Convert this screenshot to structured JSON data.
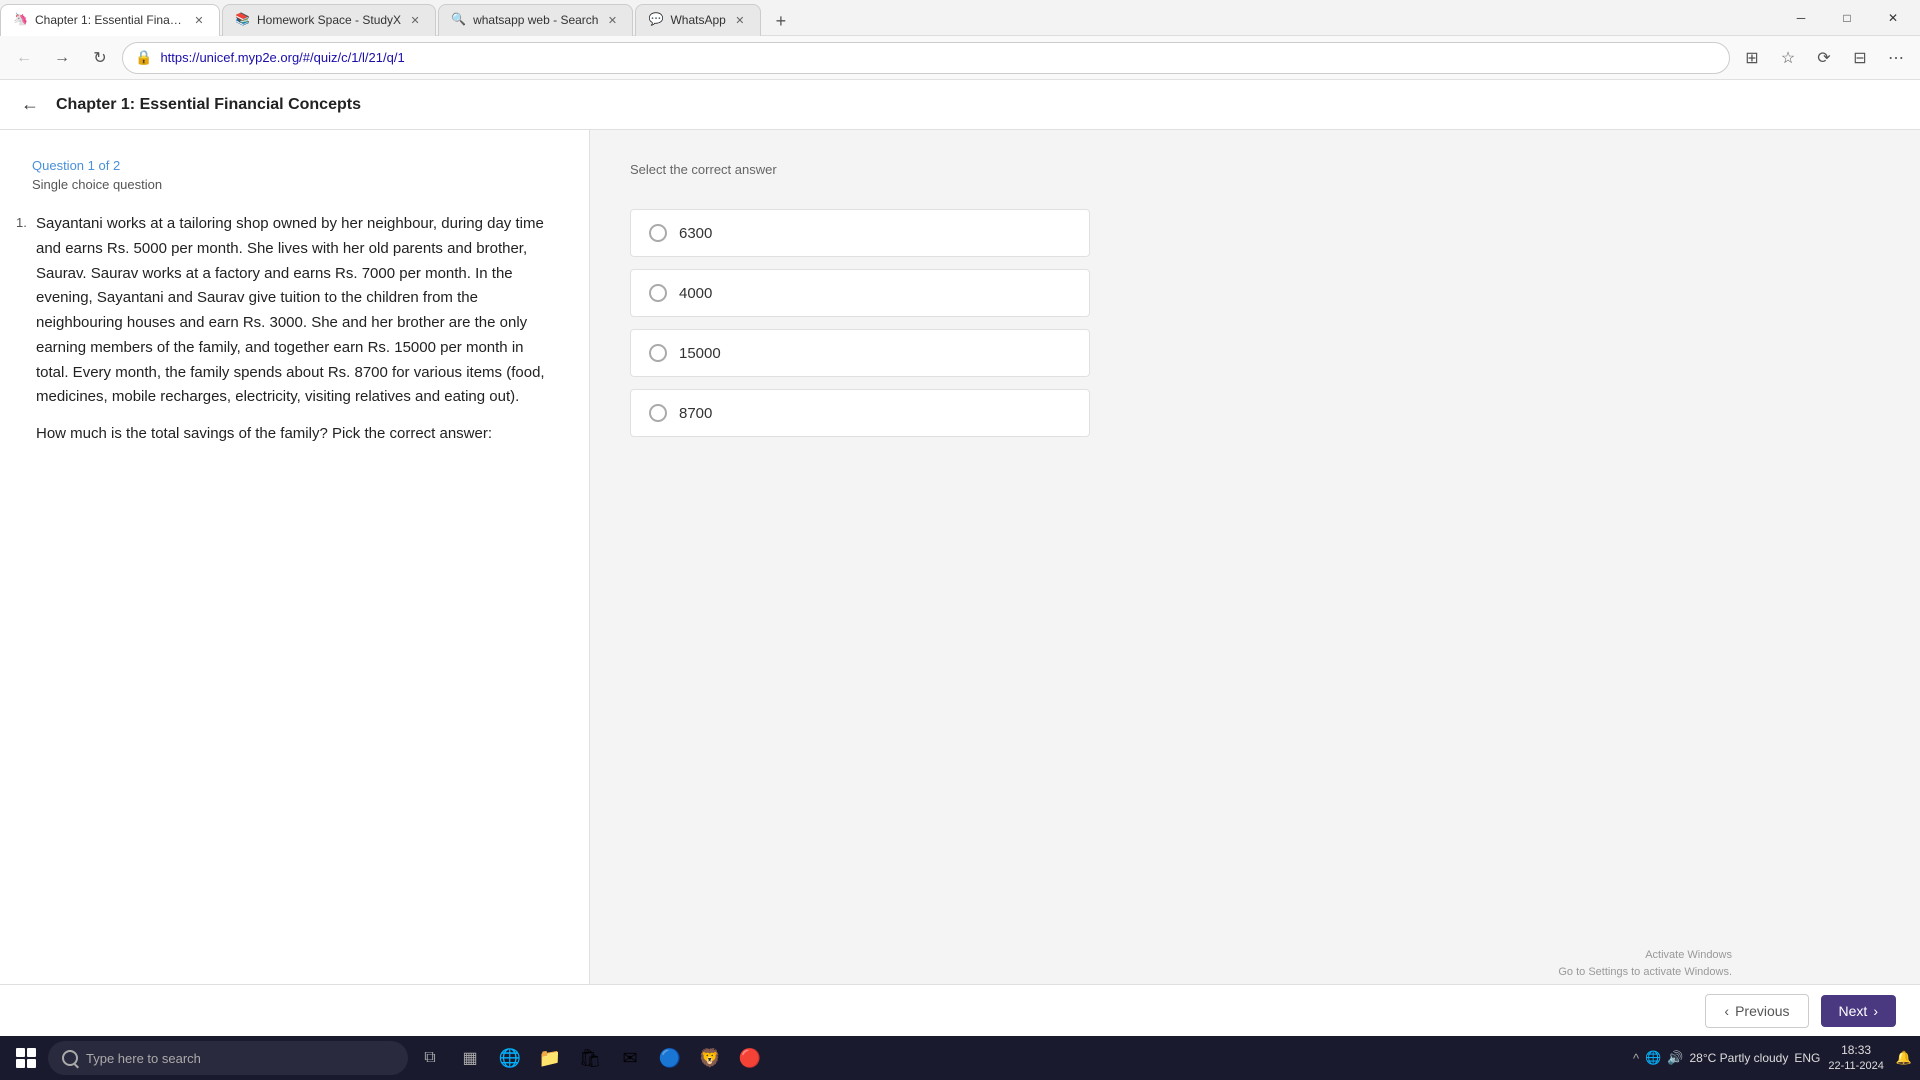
{
  "browser": {
    "tabs": [
      {
        "id": "tab1",
        "title": "Chapter 1: Essential Financial Co...",
        "favicon": "🦄",
        "active": true,
        "url": "https://unicef.myp2e.org/#/quiz/c/1/l/21/q/1"
      },
      {
        "id": "tab2",
        "title": "Homework Space - StudyX",
        "favicon": "📚",
        "active": false
      },
      {
        "id": "tab3",
        "title": "whatsapp web - Search",
        "favicon": "🔍",
        "active": false
      },
      {
        "id": "tab4",
        "title": "WhatsApp",
        "favicon": "💬",
        "active": false
      }
    ],
    "address": "https://unicef.myp2e.org/#/quiz/c/1/l/21/q/1"
  },
  "page": {
    "title": "Chapter 1: Essential Financial Concepts",
    "back_label": "←"
  },
  "question": {
    "number": "Question 1 of 2",
    "type": "Single choice question",
    "index": "1.",
    "text": "Sayantani works at a tailoring shop owned by her neighbour, during day time and earns Rs. 5000 per month. She lives with her old parents and brother, Saurav. Saurav works at a factory and earns Rs. 7000 per month. In the evening, Sayantani and Saurav give tuition to the children from the neighbouring houses and earn Rs. 3000. She and her brother are the only earning members of the family, and together earn Rs. 15000 per month in total. Every month, the family spends about Rs. 8700 for various items (food, medicines, mobile recharges, electricity, visiting relatives and eating out).",
    "question_prompt": "How much is the total savings of the family? Pick the correct answer:"
  },
  "answers": {
    "instruction": "Select the correct answer",
    "options": [
      {
        "id": "opt1",
        "value": "6300"
      },
      {
        "id": "opt2",
        "value": "4000"
      },
      {
        "id": "opt3",
        "value": "15000"
      },
      {
        "id": "opt4",
        "value": "8700"
      }
    ]
  },
  "navigation": {
    "previous_label": "Previous",
    "next_label": "Next",
    "previous_icon": "‹",
    "next_icon": "›"
  },
  "activate_windows": {
    "line1": "Activate Windows",
    "line2": "Go to Settings to activate Windows."
  },
  "taskbar": {
    "search_placeholder": "Type here to search",
    "clock": {
      "time": "18:33",
      "date": "22-11-2024"
    },
    "weather": "28°C  Partly cloudy",
    "language": "ENG"
  }
}
